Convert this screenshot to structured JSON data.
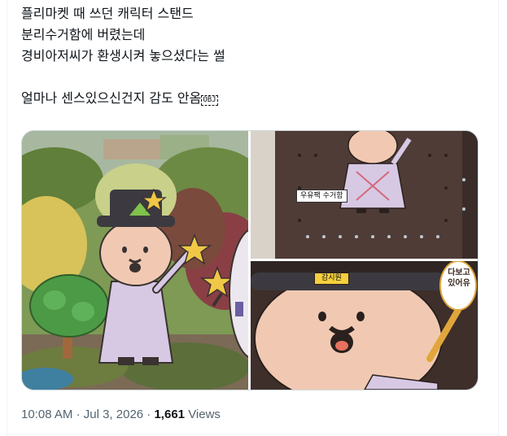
{
  "tweet": {
    "lines": [
      "플리마켓 때 쓰던 캐릭터 스탠드",
      "분리수거함에 버렸는데",
      "경비아저씨가 환생시켜 놓으셨다는 썰",
      "",
      "얼마나 센스있으신건지 감도 안옴"
    ],
    "obj_glyph": "OBJ"
  },
  "media": {
    "top_right_sign": "우유팩 수거함",
    "bottom_right_nameplate": "감시원",
    "bottom_right_bubble": [
      "다보고",
      "있어유"
    ]
  },
  "meta": {
    "time": "10:08 AM",
    "date": "Jul 3, 2026",
    "separator": "·",
    "views_count": "1,661",
    "views_label": "Views"
  }
}
